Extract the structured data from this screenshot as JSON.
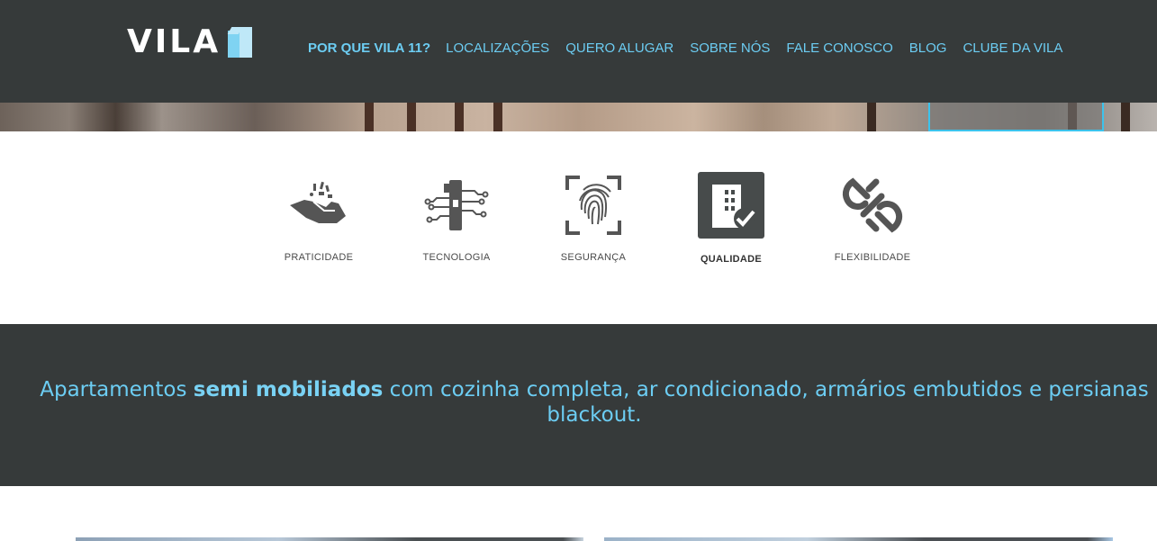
{
  "header": {
    "logo": {
      "text": "VILA",
      "mark": "11"
    },
    "nav": [
      {
        "label": "POR QUE VILA 11?",
        "active": true
      },
      {
        "label": "LOCALIZAÇÕES",
        "active": false
      },
      {
        "label": "QUERO ALUGAR",
        "active": false
      },
      {
        "label": "SOBRE NÓS",
        "active": false
      },
      {
        "label": "FALE CONOSCO",
        "active": false
      },
      {
        "label": "BLOG",
        "active": false
      },
      {
        "label": "CLUBE DA VILA",
        "active": false
      }
    ]
  },
  "features": [
    {
      "label": "PRATICIDADE",
      "icon": "hand-icon",
      "active": false
    },
    {
      "label": "TECNOLOGIA",
      "icon": "circuit-icon",
      "active": false
    },
    {
      "label": "SEGURANÇA",
      "icon": "fingerprint-icon",
      "active": false
    },
    {
      "label": "QUALIDADE",
      "icon": "building-check-icon",
      "active": true
    },
    {
      "label": "FLEXIBILIDADE",
      "icon": "link-icon",
      "active": false
    }
  ],
  "banner": {
    "text_before": "Apartamentos ",
    "text_bold": "semi mobiliados",
    "text_after": " com cozinha completa, ar condicionado, armários embutidos e persianas blackout."
  },
  "colors": {
    "header_bg": "#363a3a",
    "accent": "#6ccdf3",
    "icon_gray": "#555555"
  }
}
